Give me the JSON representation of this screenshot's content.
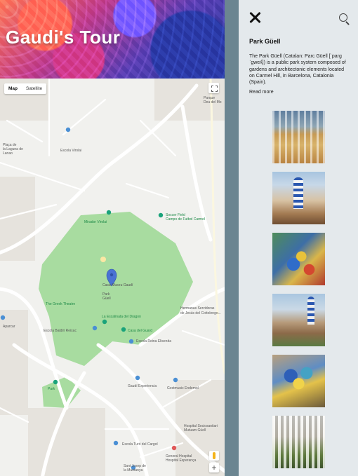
{
  "app": {
    "title": "Gaudi's Tour"
  },
  "map": {
    "tabs": [
      "Map",
      "Satellite"
    ],
    "zoom_in": "+",
    "labels": {
      "mirador": "Mirador Virolai",
      "escola_virolai": "Escola Virolai",
      "soccer": "Soccer Field",
      "soccer_sub": "Campo de Futbol Carmel",
      "casa_museu": "Casa-Museu Gaudí",
      "park": "Park",
      "guell": "Güell",
      "greek_theatre": "The Greek Theatre",
      "escalinata": "La Escalinata del Dragon",
      "casa_guell": "Casa del Guard",
      "escola_reina": "Escola Reina Elisenda",
      "escola_baldiri": "Escola Baldiri Reixac",
      "hermanas": "Hermanas Servidoras",
      "hermanas_sub": "de Jesús del Cottolengo...",
      "park2": "Park",
      "gaudi_exp": "Gaudí Experiencia",
      "gestmusic": "Gestmusic Endemol",
      "escola_turo": "Escola Turó del Cargol",
      "hospital_soc": "Hospital Sociosanitari",
      "hospital_soc_sub": "Mutuam Güell",
      "general_hosp": "General Hospital",
      "general_hosp_sub": "Hospital Esperança",
      "sant_josep": "Sant Josep de",
      "sant_josep_sub": "la Muntanya",
      "aparcar": "Aparcar",
      "placa_laguna": "Plaça de",
      "placa_laguna_sub": "la Laguna de",
      "placa_laguna_sub2": "Lanao",
      "parque": "Parque",
      "parque_sub": "Deu del Mo"
    }
  },
  "panel": {
    "title": "Park Güell",
    "description": "The Park Güell (Catalan: Parc Güell [ˈparɡ ˈɡweʎ]) is a public park system composed of gardens and architectonic elements located on Carmel Hill, in Barcelona, Catalonia (Spain).",
    "read_more": "Read more",
    "images": [
      "park-guell-photo-1",
      "park-guell-photo-2",
      "park-guell-photo-3",
      "park-guell-photo-4",
      "park-guell-photo-5",
      "park-guell-photo-6"
    ]
  },
  "colors": {
    "divider": "#6b8591",
    "panel_bg": "#e4e9ec",
    "park_green": "#a8dca0",
    "marker": "#4a72d4"
  }
}
